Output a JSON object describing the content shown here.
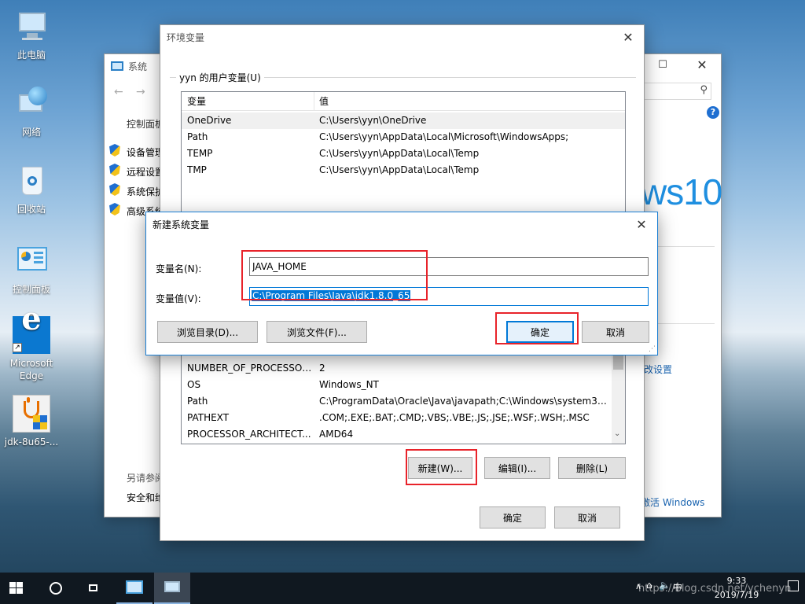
{
  "desktop": {
    "icons": [
      {
        "label": "此电脑",
        "icon": "computer-icon"
      },
      {
        "label": "网络",
        "icon": "network-icon"
      },
      {
        "label": "回收站",
        "icon": "recycle-bin-icon"
      },
      {
        "label": "控制面板",
        "icon": "control-panel-icon"
      },
      {
        "label": "Microsoft Edge",
        "icon": "edge-icon"
      },
      {
        "label": "jdk-8u65-...",
        "icon": "java-installer-icon"
      }
    ]
  },
  "system_window": {
    "title": "系统",
    "nav_label": "控制面板",
    "links": [
      "设备管理",
      "远程设置",
      "系统保护",
      "高级系统"
    ],
    "see_also": "另请参阅",
    "security": "安全和维",
    "win10_brand": "ws10",
    "change_settings": "改设置",
    "activate": "激活 Windows"
  },
  "env_window": {
    "title": "环境变量",
    "user_group_label": "yyn 的用户变量(U)",
    "table_headers": [
      "变量",
      "值"
    ],
    "user_vars": [
      {
        "name": "OneDrive",
        "value": "C:\\Users\\yyn\\OneDrive"
      },
      {
        "name": "Path",
        "value": "C:\\Users\\yyn\\AppData\\Local\\Microsoft\\WindowsApps;"
      },
      {
        "name": "TEMP",
        "value": "C:\\Users\\yyn\\AppData\\Local\\Temp"
      },
      {
        "name": "TMP",
        "value": "C:\\Users\\yyn\\AppData\\Local\\Temp"
      }
    ],
    "system_vars": [
      {
        "name": "NUMBER_OF_PROCESSORS",
        "value": "2"
      },
      {
        "name": "OS",
        "value": "Windows_NT"
      },
      {
        "name": "Path",
        "value": "C:\\ProgramData\\Oracle\\Java\\javapath;C:\\Windows\\system32;..."
      },
      {
        "name": "PATHEXT",
        "value": ".COM;.EXE;.BAT;.CMD;.VBS;.VBE;.JS;.JSE;.WSF;.WSH;.MSC"
      },
      {
        "name": "PROCESSOR_ARCHITECT...",
        "value": "AMD64"
      }
    ],
    "buttons": {
      "new": "新建(W)...",
      "edit": "编辑(I)...",
      "delete": "删除(L)",
      "ok": "确定",
      "cancel": "取消"
    }
  },
  "new_var_dialog": {
    "title": "新建系统变量",
    "name_label": "变量名(N):",
    "name_value": "JAVA_HOME",
    "value_label": "变量值(V):",
    "value_value": "C:\\Program Files\\Java\\jdk1.8.0_65",
    "browse_dir": "浏览目录(D)...",
    "browse_file": "浏览文件(F)...",
    "ok": "确定",
    "cancel": "取消"
  },
  "taskbar": {
    "time": "9:33",
    "date": "2019/7/19",
    "watermark": "https://blog.csdn.net/ychenyn",
    "tray_ime": "中"
  },
  "colors": {
    "accent": "#0078d7",
    "highlight": "#e8232a",
    "selection": "#0078d7"
  }
}
